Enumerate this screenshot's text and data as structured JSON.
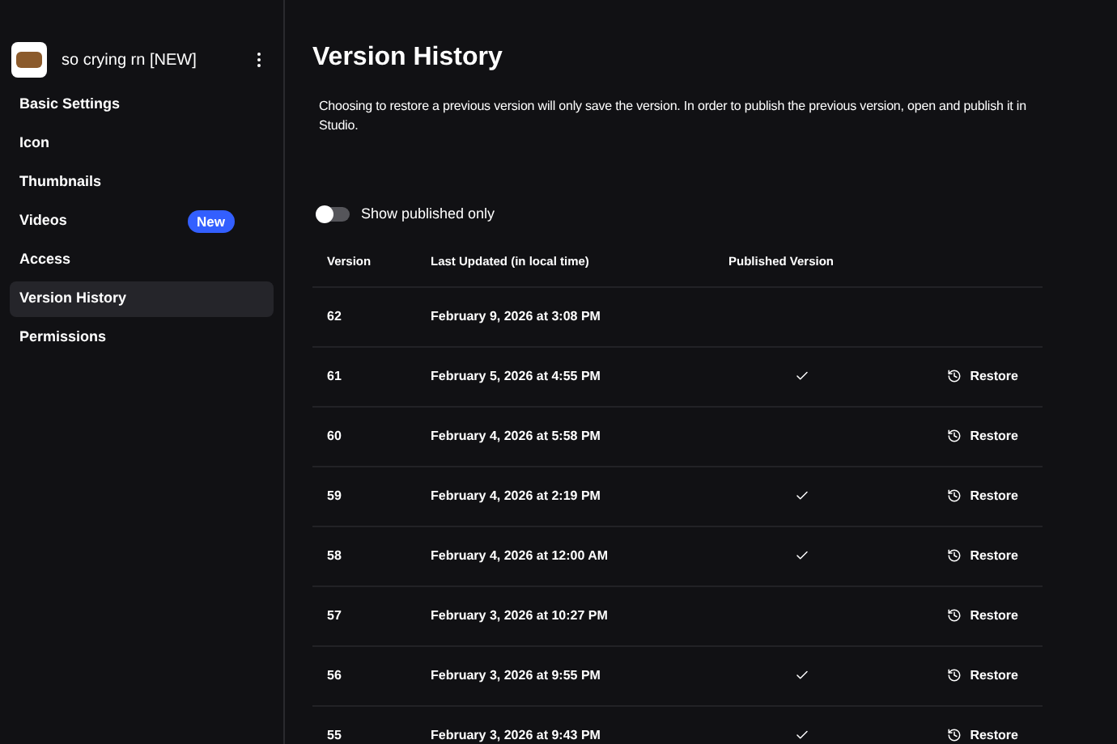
{
  "sidebar": {
    "experience": {
      "name": "so crying rn [NEW]"
    },
    "items": [
      {
        "label": "Basic Settings",
        "selected": false
      },
      {
        "label": "Icon",
        "selected": false
      },
      {
        "label": "Thumbnails",
        "selected": false
      },
      {
        "label": "Videos",
        "selected": false,
        "badge": "New"
      },
      {
        "label": "Access",
        "selected": false
      },
      {
        "label": "Version History",
        "selected": true
      },
      {
        "label": "Permissions",
        "selected": false
      }
    ]
  },
  "page": {
    "title": "Version History",
    "description": "Choosing to restore a previous version will only save the version. In order to publish the previous version, open and publish it in Studio."
  },
  "filter": {
    "label": "Show published only",
    "on": false
  },
  "table": {
    "columns": [
      "Version",
      "Last Updated (in local time)",
      "Published Version"
    ],
    "rows": [
      {
        "version": "62",
        "updated": "February 9, 2026 at 3:08 PM",
        "published": false
      },
      {
        "version": "61",
        "updated": "February 5, 2026 at 4:55 PM",
        "published": true,
        "action": "Restore"
      },
      {
        "version": "60",
        "updated": "February 4, 2026 at 5:58 PM",
        "published": false,
        "action": "Restore"
      },
      {
        "version": "59",
        "updated": "February 4, 2026 at 2:19 PM",
        "published": true,
        "action": "Restore"
      },
      {
        "version": "58",
        "updated": "February 4, 2026 at 12:00 AM",
        "published": true,
        "action": "Restore"
      },
      {
        "version": "57",
        "updated": "February 3, 2026 at 10:27 PM",
        "published": false,
        "action": "Restore"
      },
      {
        "version": "56",
        "updated": "February 3, 2026 at 9:55 PM",
        "published": true,
        "action": "Restore"
      },
      {
        "version": "55",
        "updated": "February 3, 2026 at 9:43 PM",
        "published": true,
        "action": "Restore"
      }
    ]
  }
}
